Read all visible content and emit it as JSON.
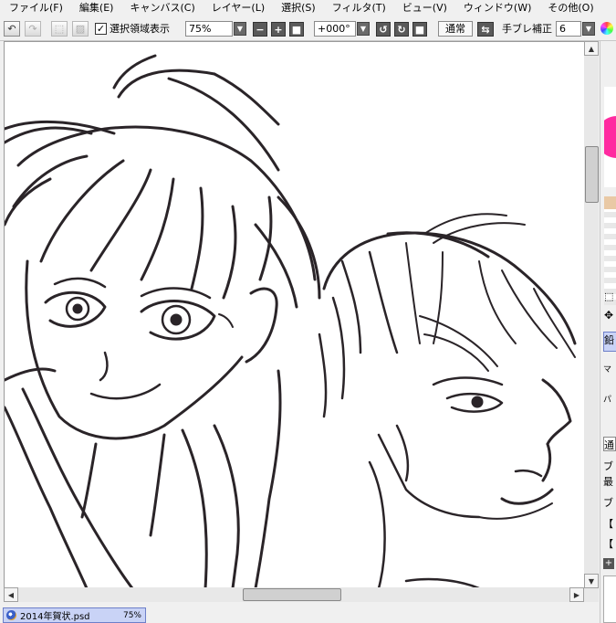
{
  "menu": {
    "items": [
      "ファイル(F)",
      "編集(E)",
      "キャンバス(C)",
      "レイヤー(L)",
      "選択(S)",
      "フィルタ(T)",
      "ビュー(V)",
      "ウィンドウ(W)",
      "その他(O)"
    ]
  },
  "toolbar": {
    "show_selection_label": "選択領域表示",
    "show_selection_checked": "✓",
    "zoom_value": "75%",
    "rotation_value": "+000°",
    "blend_mode_label": "通常",
    "stabilizer_label": "手ブレ補正",
    "stabilizer_value": "6"
  },
  "right_panel": {
    "texts": [
      "鉛",
      "マ",
      "パ",
      "通",
      "ブ",
      "最",
      "ブ",
      "【",
      "【"
    ]
  },
  "document": {
    "filename": "2014年賀状.psd",
    "zoom": "75%"
  },
  "colors": {
    "canvas_bg": "#ffffff",
    "ink": "#2a2428",
    "tab_active": "#c9d3f6"
  }
}
